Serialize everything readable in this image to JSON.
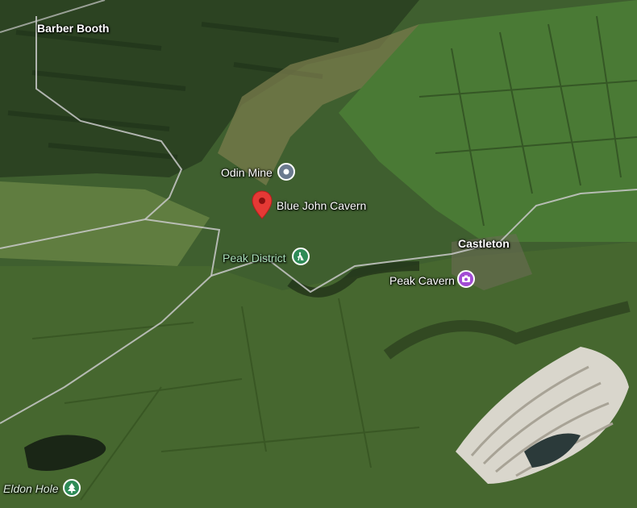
{
  "map": {
    "type": "satellite",
    "places": {
      "barber_booth": "Barber Booth",
      "odin_mine": "Odin Mine",
      "blue_john_cavern": "Blue John Cavern",
      "peak_district": "Peak District",
      "castleton": "Castleton",
      "peak_cavern": "Peak Cavern",
      "eldon_hole": "Eldon Hole"
    },
    "colors": {
      "selected_pin": "#e53935",
      "mine_poi": "#6b7a8f",
      "park_poi": "#2e8b57",
      "attraction_poi": "#a24bd4"
    }
  }
}
